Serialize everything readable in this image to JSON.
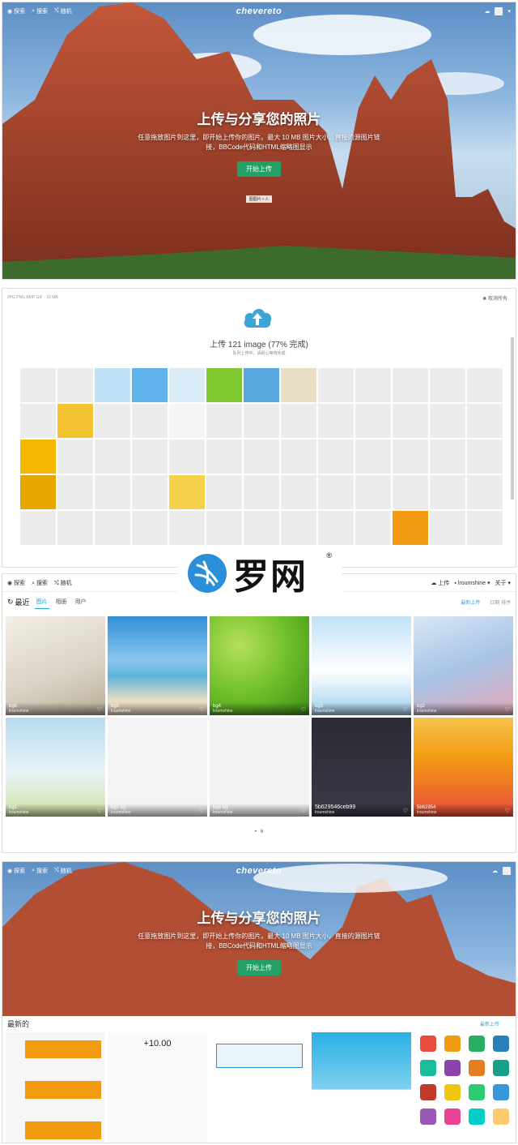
{
  "colors": {
    "accent_green": "#23a065",
    "link_blue": "#4aa0d5",
    "orange": "#f39c12"
  },
  "hero": {
    "nav": {
      "explore": "探索",
      "search": "搜索",
      "random": "随机"
    },
    "logo": "chevereto",
    "title": "上传与分享您的照片",
    "subtitle_line1": "任意拖放图片到这里，即开始上传你的图片。最大 10 MB 图片大小，直接的源图片链",
    "subtitle_line2": "接，BBCode代码和HTML缩略图显示",
    "button": "开始上传",
    "chip": "图图片 • 人"
  },
  "upload": {
    "formats": "JPG PNG BMP GIF · 10 MB",
    "close": "取消所有",
    "title": "上传 121 image (77% 完成)",
    "subtitle": "队列上传中，请耐心等待完成"
  },
  "gallery": {
    "nav": {
      "explore": "探索",
      "search": "搜索",
      "random": "随机"
    },
    "upload": "上传",
    "user": "lroumshine",
    "about": "关于",
    "section": "最近",
    "tabs": [
      "图片",
      "相册",
      "用户"
    ],
    "sort": "最新上传",
    "sort2": "日期 排序",
    "items": [
      {
        "name": "bg6",
        "user": "lroumshine"
      },
      {
        "name": "bg5",
        "user": "lroumshine"
      },
      {
        "name": "bg4",
        "user": "lroumshine"
      },
      {
        "name": "bg3",
        "user": "lroumshine"
      },
      {
        "name": "bg2",
        "user": "lroumshine"
      },
      {
        "name": "bg1",
        "user": "lroumshine"
      },
      {
        "name": "bg7 bg",
        "user": "lroumshine"
      },
      {
        "name": "bg8 bg",
        "user": "lroumshine"
      },
      {
        "name": "5b629546ceb99",
        "user": "lroumshine"
      },
      {
        "name": "5b62954",
        "user": "lroumshine"
      }
    ],
    "page": "6"
  },
  "watermark": {
    "text": "罗网",
    "reg": "®"
  },
  "bottom": {
    "title": "上传与分享您的照片",
    "subtitle_line1": "任意拖放图片到这里，即开始上传你的图片。最大 10 MB 图片大小，直接的源图片链",
    "subtitle_line2": "接，BBCode代码和HTML缩略图显示",
    "button": "开始上传",
    "latest": "最新的",
    "latest_sort": "最新上传",
    "amount": "+10.00"
  }
}
